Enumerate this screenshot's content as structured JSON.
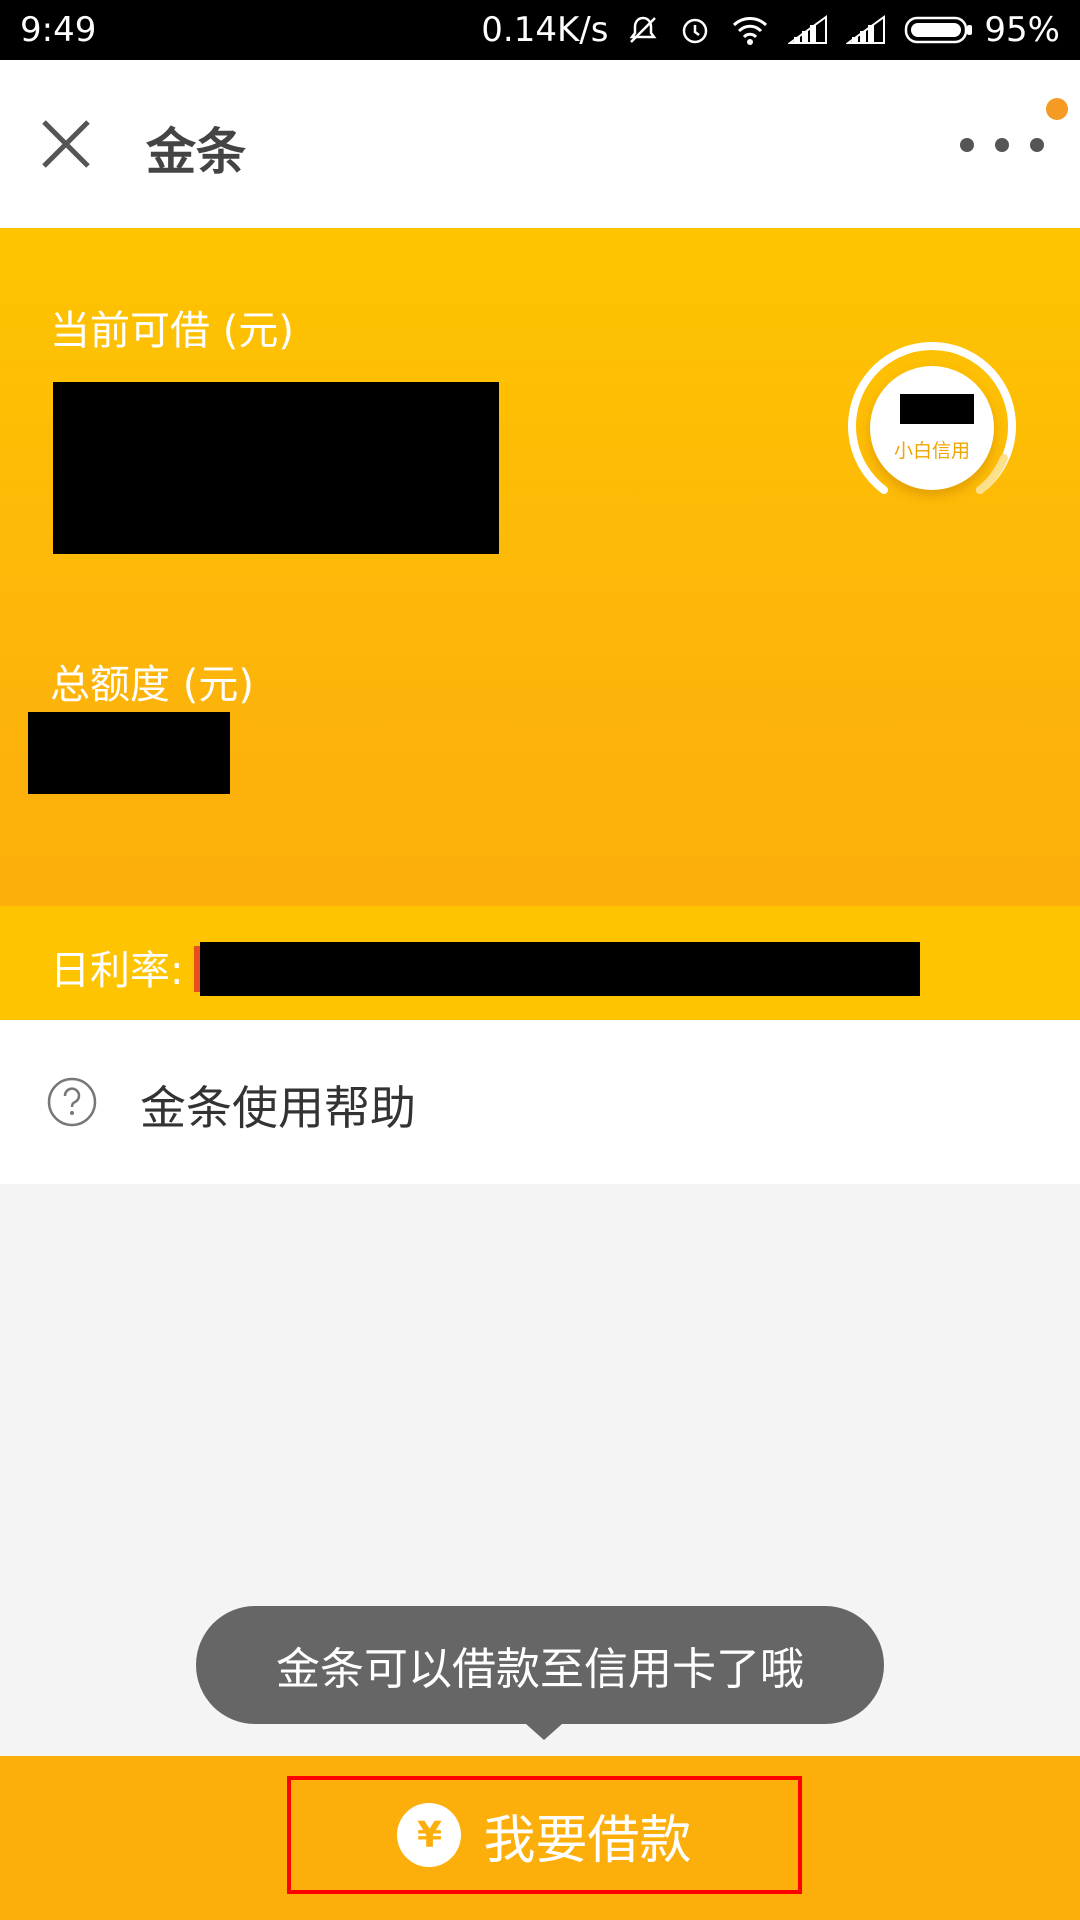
{
  "status_bar": {
    "time": "9:49",
    "network_speed": "0.14K/s",
    "battery": "95%"
  },
  "app_bar": {
    "title": "金条"
  },
  "card": {
    "available_label": "当前可借 (元)",
    "total_label": "总额度 (元)",
    "credit_label": "小白信用"
  },
  "rate": {
    "label": "日利率:"
  },
  "help": {
    "label": "金条使用帮助"
  },
  "toast": {
    "text": "金条可以借款至信用卡了哦"
  },
  "bottom": {
    "button_label": "我要借款",
    "button_icon": "¥"
  },
  "colors": {
    "primary_yellow": "#fec400",
    "accent_orange": "#fcae0a",
    "highlight_border": "#ff0000"
  }
}
